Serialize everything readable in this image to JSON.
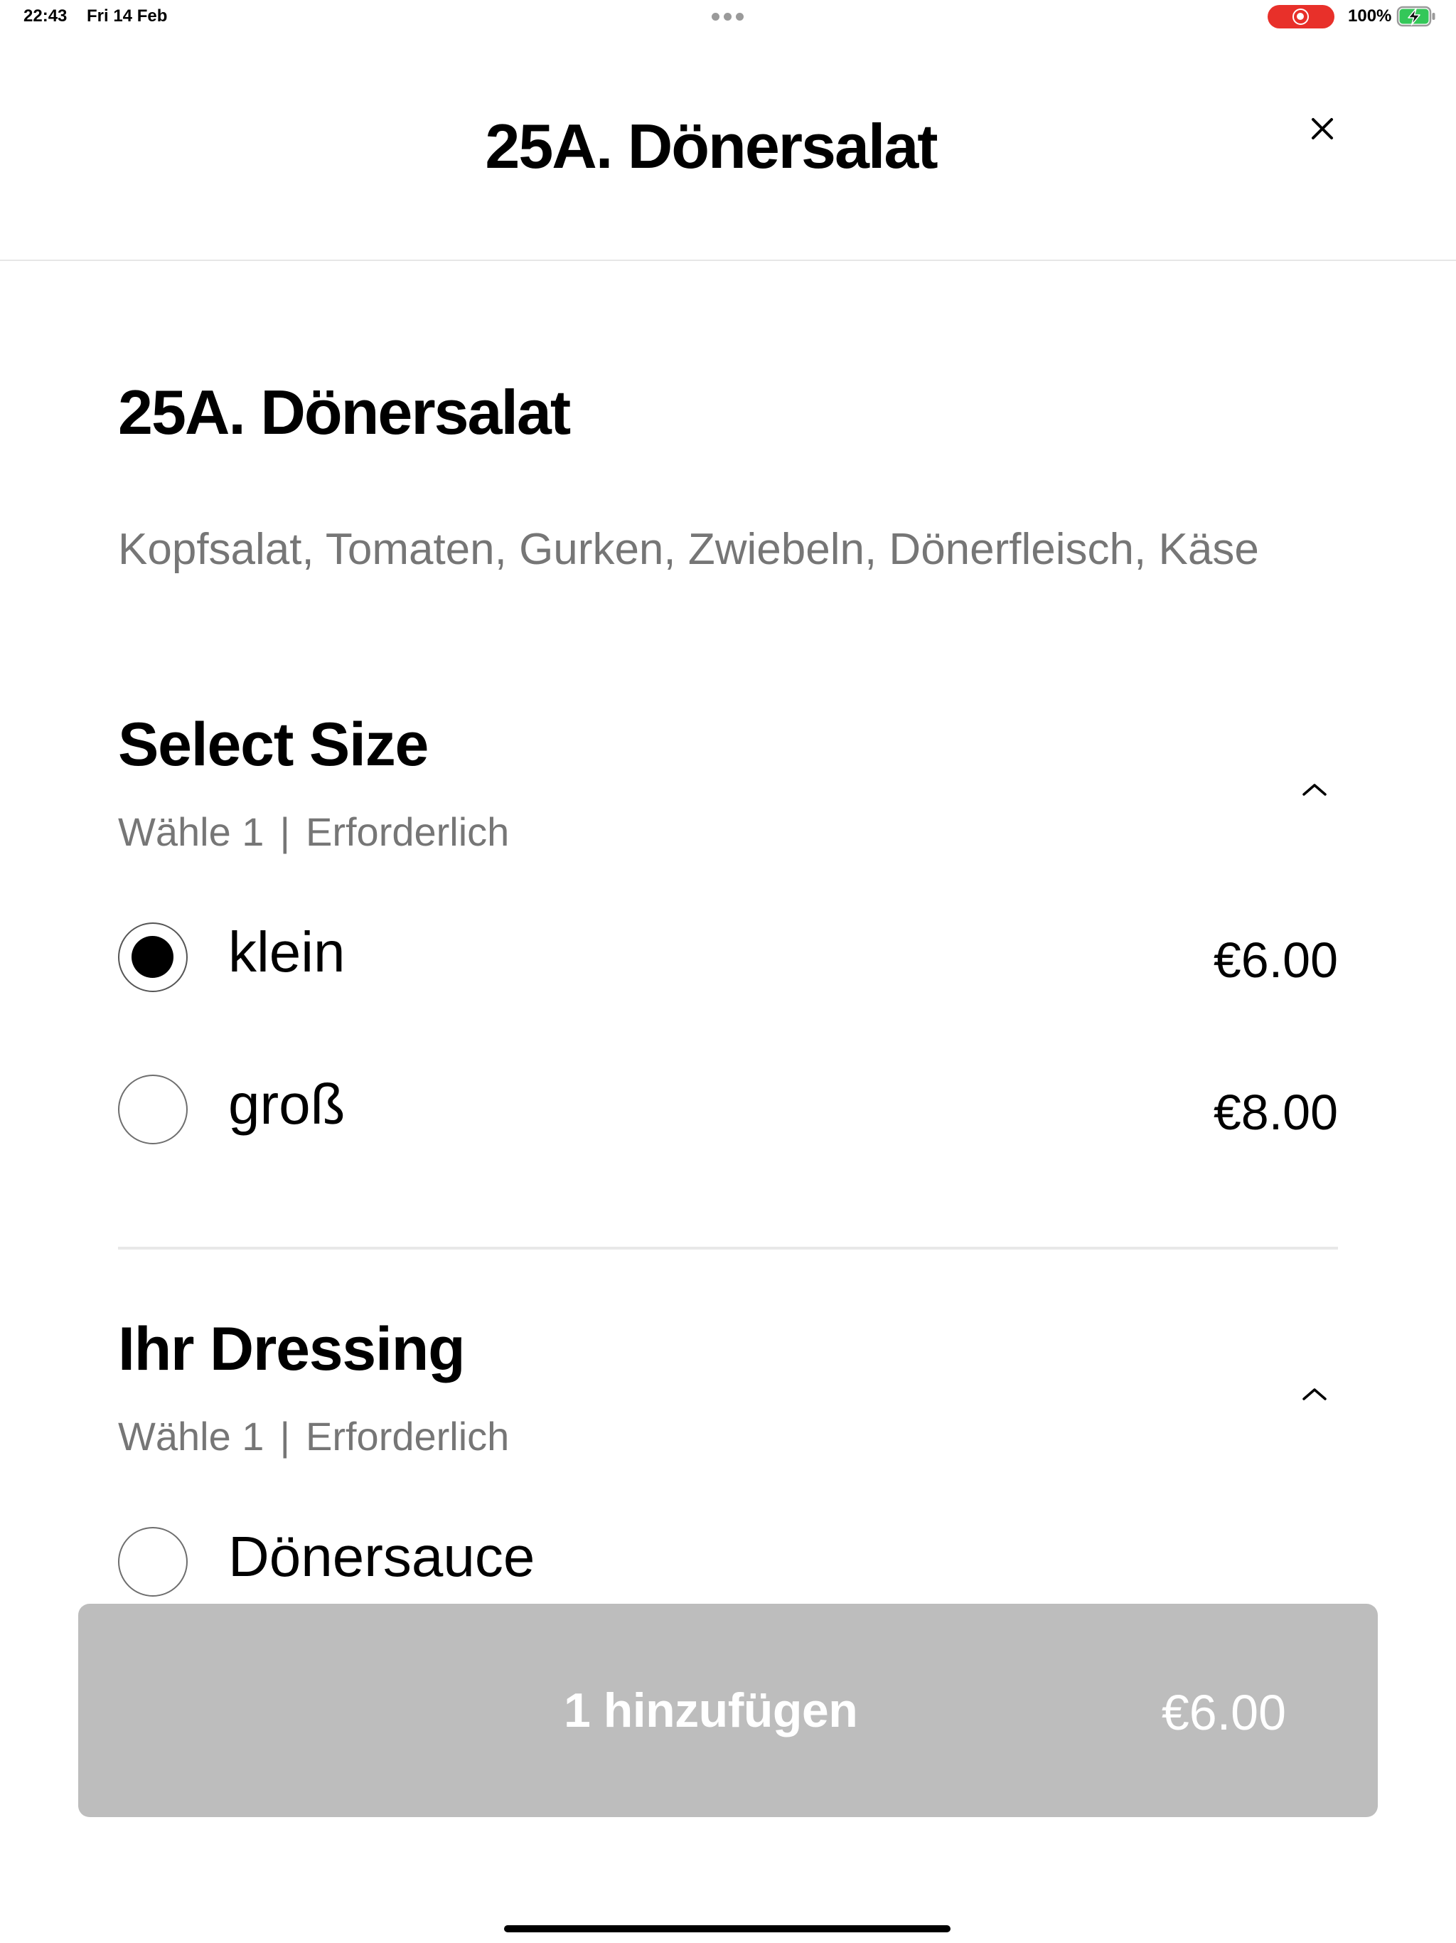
{
  "status_bar": {
    "time": "22:43",
    "date": "Fri 14 Feb",
    "multitasking_icon": "multitasking-dots-icon",
    "recording_icon": "screen-recording-icon",
    "battery_percent": "100%",
    "battery_icon": "battery-charging-icon",
    "battery_level": 1.0
  },
  "header": {
    "title": "25A. Dönersalat",
    "close_icon": "close-icon"
  },
  "item": {
    "title": "25A. Dönersalat",
    "description": "Kopfsalat, Tomaten, Gurken, Zwiebeln, Dönerfleisch, Käse"
  },
  "option_groups": [
    {
      "title": "Select Size",
      "rule": "Wähle 1",
      "separator": "|",
      "requirement": "Erforderlich",
      "collapse_icon": "chevron-up-icon",
      "options": [
        {
          "label": "klein",
          "price": "€6.00",
          "selected": true
        },
        {
          "label": "groß",
          "price": "€8.00",
          "selected": false
        }
      ]
    },
    {
      "title": "Ihr Dressing",
      "rule": "Wähle 1",
      "separator": "|",
      "requirement": "Erforderlich",
      "collapse_icon": "chevron-up-icon",
      "options": [
        {
          "label": "Dönersauce",
          "selected": false
        }
      ]
    }
  ],
  "footer": {
    "add_button_label": "1 hinzufügen",
    "add_button_price": "€6.00",
    "home_indicator_icon": "home-indicator"
  },
  "colors": {
    "text_primary": "#000000",
    "text_secondary": "#767676",
    "divider": "#e6e6e6",
    "button_disabled_bg": "#bdbdbd",
    "button_text": "#ffffff",
    "recording_red": "#e8302a",
    "battery_green": "#34c759"
  }
}
